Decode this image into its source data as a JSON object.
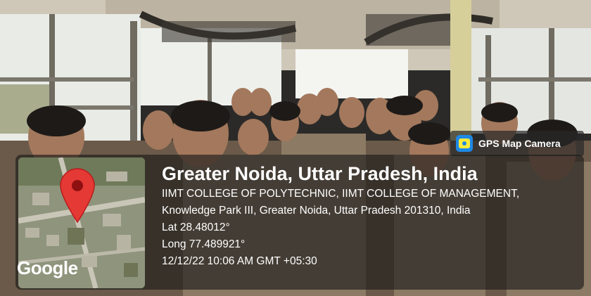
{
  "badge": {
    "label": "GPS Map Camera",
    "icon": "gps-camera-icon"
  },
  "map": {
    "logo_text": "Google",
    "pin_icon": "map-pin-icon",
    "pin_color": "#e53935"
  },
  "location": {
    "title": "Greater Noida, Uttar Pradesh, India",
    "address_line1": "IIMT COLLEGE OF POLYTECHNIC, IIMT COLLEGE OF MANAGEMENT,",
    "address_line2": "Knowledge Park III, Greater Noida, Uttar Pradesh 201310, India",
    "lat": "Lat 28.48012°",
    "long": "Long 77.489921°",
    "timestamp": "12/12/22 10:06 AM GMT +05:30"
  }
}
